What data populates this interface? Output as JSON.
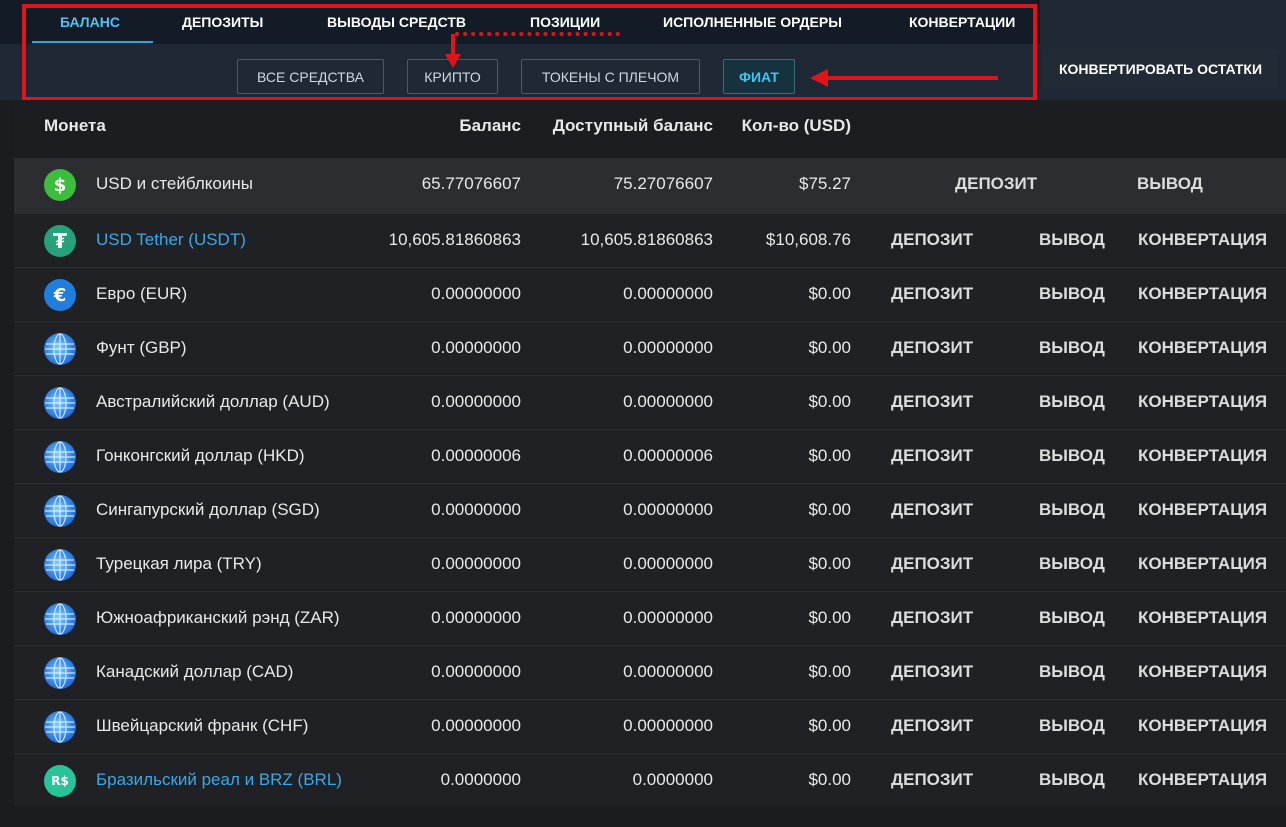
{
  "tabs": [
    {
      "label": "БАЛАНС",
      "active": true
    },
    {
      "label": "ДЕПОЗИТЫ",
      "active": false
    },
    {
      "label": "ВЫВОДЫ СРЕДСТВ",
      "active": false
    },
    {
      "label": "ПОЗИЦИИ",
      "active": false
    },
    {
      "label": "ИСПОЛНЕННЫЕ ОРДЕРЫ",
      "active": false
    },
    {
      "label": "КОНВЕРТАЦИИ",
      "active": false
    }
  ],
  "filters": [
    {
      "label": "ВСЕ СРЕДСТВА",
      "active": false
    },
    {
      "label": "КРИПТО",
      "active": false
    },
    {
      "label": "ТОКЕНЫ С ПЛЕЧОМ",
      "active": false
    },
    {
      "label": "ФИАТ",
      "active": true
    }
  ],
  "convert_button": "КОНВЕРТИРОВАТЬ ОСТАТКИ",
  "columns": {
    "coin": "Монета",
    "balance": "Баланс",
    "available": "Доступный баланс",
    "usd": "Кол-во (USD)"
  },
  "rows": [
    {
      "icon": "dollar-icon",
      "name": "USD и стейблкоины",
      "balance": "65.77076607",
      "available": "75.27076607",
      "usd": "$75.27",
      "actions": [
        "ДЕПОЗИТ",
        "ВЫВОД"
      ]
    },
    {
      "icon": "tether-icon",
      "name": "USD Tether (USDT)",
      "balance": "10,605.81860863",
      "available": "10,605.81860863",
      "usd": "$10,608.76",
      "actions": [
        "ДЕПОЗИТ",
        "ВЫВОД",
        "КОНВЕРТАЦИЯ"
      ]
    },
    {
      "icon": "euro-icon",
      "name": "Евро (EUR)",
      "balance": "0.00000000",
      "available": "0.00000000",
      "usd": "$0.00",
      "actions": [
        "ДЕПОЗИТ",
        "ВЫВОД",
        "КОНВЕРТАЦИЯ"
      ]
    },
    {
      "icon": "globe-icon",
      "name": "Фунт (GBP)",
      "balance": "0.00000000",
      "available": "0.00000000",
      "usd": "$0.00",
      "actions": [
        "ДЕПОЗИТ",
        "ВЫВОД",
        "КОНВЕРТАЦИЯ"
      ]
    },
    {
      "icon": "globe-icon",
      "name": "Австралийский доллар (AUD)",
      "balance": "0.00000000",
      "available": "0.00000000",
      "usd": "$0.00",
      "actions": [
        "ДЕПОЗИТ",
        "ВЫВОД",
        "КОНВЕРТАЦИЯ"
      ]
    },
    {
      "icon": "globe-icon",
      "name": "Гонконгский доллар (HKD)",
      "balance": "0.00000006",
      "available": "0.00000006",
      "usd": "$0.00",
      "actions": [
        "ДЕПОЗИТ",
        "ВЫВОД",
        "КОНВЕРТАЦИЯ"
      ]
    },
    {
      "icon": "globe-icon",
      "name": "Сингапурский доллар (SGD)",
      "balance": "0.00000000",
      "available": "0.00000000",
      "usd": "$0.00",
      "actions": [
        "ДЕПОЗИТ",
        "ВЫВОД",
        "КОНВЕРТАЦИЯ"
      ]
    },
    {
      "icon": "globe-icon",
      "name": "Турецкая лира (TRY)",
      "balance": "0.00000000",
      "available": "0.00000000",
      "usd": "$0.00",
      "actions": [
        "ДЕПОЗИТ",
        "ВЫВОД",
        "КОНВЕРТАЦИЯ"
      ]
    },
    {
      "icon": "globe-icon",
      "name": "Южноафриканский рэнд (ZAR)",
      "balance": "0.00000000",
      "available": "0.00000000",
      "usd": "$0.00",
      "actions": [
        "ДЕПОЗИТ",
        "ВЫВОД",
        "КОНВЕРТАЦИЯ"
      ]
    },
    {
      "icon": "globe-icon",
      "name": "Канадский доллар (CAD)",
      "balance": "0.00000000",
      "available": "0.00000000",
      "usd": "$0.00",
      "actions": [
        "ДЕПОЗИТ",
        "ВЫВОД",
        "КОНВЕРТАЦИЯ"
      ]
    },
    {
      "icon": "globe-icon",
      "name": "Швейцарский франк (CHF)",
      "balance": "0.00000000",
      "available": "0.00000000",
      "usd": "$0.00",
      "actions": [
        "ДЕПОЗИТ",
        "ВЫВОД",
        "КОНВЕРТАЦИЯ"
      ]
    },
    {
      "icon": "real-icon",
      "name": "Бразильский реал и BRZ (BRL)",
      "balance": "0.0000000",
      "available": "0.0000000",
      "usd": "$0.00",
      "actions": [
        "ДЕПОЗИТ",
        "ВЫВОД",
        "КОНВЕРТАЦИЯ"
      ]
    }
  ],
  "icon_glyphs": {
    "dollar": "$",
    "tether": "₮",
    "euro": "€",
    "real": "R$"
  },
  "colors": {
    "accent": "#4fc3f7",
    "annotation": "#e1141a",
    "link": "#3aa8e8"
  }
}
